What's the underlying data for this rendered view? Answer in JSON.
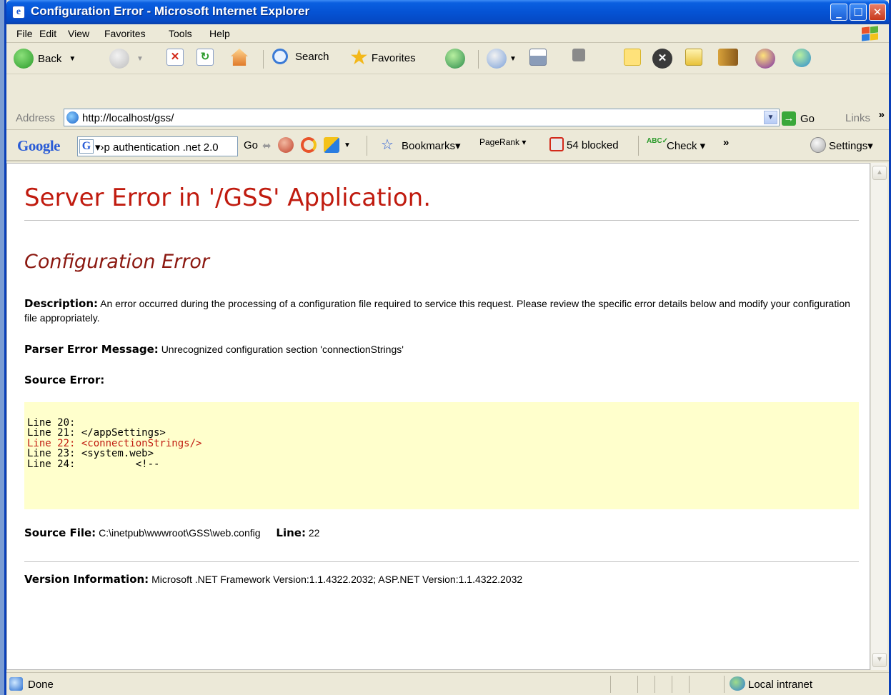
{
  "window": {
    "title": "Configuration Error - Microsoft Internet Explorer",
    "minimize": "_",
    "maximize": "☐",
    "close": "✕"
  },
  "menu": [
    "File",
    "Edit",
    "View",
    "Favorites",
    "Tools",
    "Help"
  ],
  "toolbar": {
    "back_label": "Back",
    "search_label": "Search",
    "favorites_label": "Favorites"
  },
  "address": {
    "label": "Address",
    "url": "http://localhost/gss/",
    "go_label": "Go",
    "links_label": "Links",
    "more": "»"
  },
  "google_bar": {
    "logo": "Google",
    "badge": "G",
    "query": "▾›p authentication .net 2.0",
    "go_label": "Go",
    "bookmarks_label": "Bookmarks▾",
    "pagerank_label": "PageRank ▾",
    "blocked_label": "54 blocked",
    "check_label": "Check ▾",
    "more": "»",
    "settings_label": "Settings▾"
  },
  "page": {
    "heading": "Server Error in '/GSS' Application.",
    "subheading": "Configuration Error",
    "description_label": "Description:",
    "description_text": "An error occurred during the processing of a configuration file required to service this request. Please review the specific error details below and modify your configuration file appropriately.",
    "parser_label": "Parser Error Message:",
    "parser_text": "Unrecognized configuration section 'connectionStrings'",
    "source_error_label": "Source Error:",
    "code_lines": [
      "Line 20:",
      "Line 21: </appSettings>",
      "Line 22: <connectionStrings/>",
      "Line 23: <system.web>",
      "Line 24:          <!--"
    ],
    "highlight_line_index": 2,
    "source_file_label": "Source File:",
    "source_file_path": "C:\\inetpub\\wwwroot\\GSS\\web.config",
    "line_label": "Line:",
    "line_number": "22",
    "version_label": "Version Information:",
    "version_text": "Microsoft .NET Framework Version:1.1.4322.2032; ASP.NET Version:1.1.4322.2032"
  },
  "status": {
    "text": "Done",
    "zone": "Local intranet"
  },
  "colors": {
    "title_bar": "#0553d4",
    "error_heading": "#c01b0f",
    "code_background": "#ffffcc"
  }
}
